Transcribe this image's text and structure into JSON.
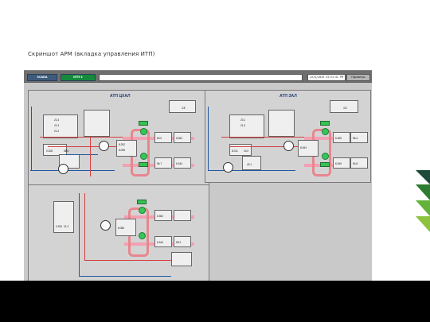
{
  "slide": {
    "title": "Скриншот АРМ (вкладка управления ИТП)"
  },
  "toolbar": {
    "tab_1": "SCADA",
    "tab_2": "ИТП-1",
    "clock": "22/4/2019 23:21:41 PM",
    "params_button": "Параметры"
  },
  "panels": {
    "left_title": "АТП ЦХАЛ",
    "right_title": "АТП ЗАЛ",
    "left_values": [
      "21.4",
      "21.3",
      "21.2",
      "0.328",
      "58.6",
      "8.292",
      "8.098",
      "60.0",
      "6.352",
      "56.7",
      "6.344",
      "55.2",
      "3.8"
    ],
    "right_values": [
      "8.011",
      "14.0",
      "40.1",
      "8.094",
      "6.355",
      "56.4",
      "6.349",
      "54.8",
      "3.8",
      "23.1",
      "21.3"
    ],
    "lower_values": [
      "0.326",
      "21.3",
      "57.9",
      "8.086",
      "6.352",
      "6.344",
      "6.349",
      "56.7",
      "55.2"
    ]
  },
  "colors": {
    "supply": "#d53e3e",
    "return": "#1f57a3",
    "running": "#34c759",
    "loop": "#e8868e"
  }
}
